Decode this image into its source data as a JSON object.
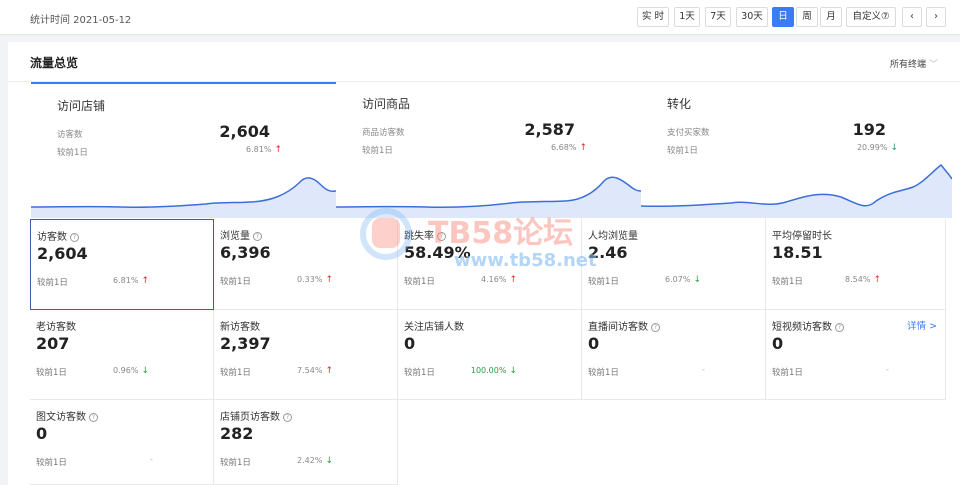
{
  "header": {
    "stat_time": "统计时间 2021-05-12",
    "buttons": [
      {
        "label": "实 时",
        "active": false
      },
      {
        "label": "1天",
        "active": false
      },
      {
        "label": "7天",
        "active": false
      },
      {
        "label": "30天",
        "active": false
      },
      {
        "label": "日",
        "active": true
      },
      {
        "label": "周",
        "active": false
      },
      {
        "label": "月",
        "active": false
      },
      {
        "label": "自定义⑦",
        "active": false
      }
    ],
    "prev_icon": "chevron-left-icon",
    "next_icon": "chevron-right-icon"
  },
  "panel": {
    "title": "流量总览",
    "terminal_select": "所有终端"
  },
  "summary": [
    {
      "title": "访问店铺",
      "label": "访客数",
      "value": "2,604",
      "compare": "较前1日",
      "pct": "6.81%",
      "trend": "up",
      "active": true
    },
    {
      "title": "访问商品",
      "label": "商品访客数",
      "value": "2,587",
      "compare": "较前1日",
      "pct": "6.68%",
      "trend": "up",
      "active": false
    },
    {
      "title": "转化",
      "label": "支付买家数",
      "value": "192",
      "compare": "较前1日",
      "pct": "20.99%",
      "trend": "down",
      "active": false
    }
  ],
  "metrics": [
    {
      "title": "访客数",
      "help": true,
      "value": "2,604",
      "compare": "较前1日",
      "pct": "6.81%",
      "trend": "up",
      "selected": true
    },
    {
      "title": "浏览量",
      "help": true,
      "value": "6,396",
      "compare": "较前1日",
      "pct": "0.33%",
      "trend": "up"
    },
    {
      "title": "跳失率",
      "help": true,
      "value": "58.49%",
      "compare": "较前1日",
      "pct": "4.16%",
      "trend": "up"
    },
    {
      "title": "人均浏览量",
      "help": false,
      "value": "2.46",
      "compare": "较前1日",
      "pct": "6.07%",
      "trend": "down"
    },
    {
      "title": "平均停留时长",
      "help": false,
      "value": "18.51",
      "compare": "较前1日",
      "pct": "8.54%",
      "trend": "up"
    },
    {
      "title": "老访客数",
      "help": false,
      "value": "207",
      "compare": "较前1日",
      "pct": "0.96%",
      "trend": "down"
    },
    {
      "title": "新访客数",
      "help": false,
      "value": "2,397",
      "compare": "较前1日",
      "pct": "7.54%",
      "trend": "up"
    },
    {
      "title": "关注店铺人数",
      "help": false,
      "value": "0",
      "compare": "较前1日",
      "pct": "100.00%",
      "trend": "down",
      "green": true
    },
    {
      "title": "直播间访客数",
      "help": true,
      "value": "0",
      "compare": "较前1日",
      "pct": "-",
      "trend": "none"
    },
    {
      "title": "短视频访客数",
      "help": true,
      "value": "0",
      "compare": "较前1日",
      "pct": "-",
      "trend": "none",
      "detail": "详情 >"
    },
    {
      "title": "图文访客数",
      "help": true,
      "value": "0",
      "compare": "较前1日",
      "pct": "-",
      "trend": "none"
    },
    {
      "title": "店铺页访客数",
      "help": true,
      "value": "282",
      "compare": "较前1日",
      "pct": "2.42%",
      "trend": "down"
    }
  ],
  "watermark": {
    "text": "TB58论坛",
    "url": "www.tb58.net"
  },
  "colors": {
    "accent": "#3b7bf7",
    "up": "#f5222d",
    "down": "#21a24a",
    "spark_line": "#3b6fd8",
    "spark_fill": "#dfe8fb"
  }
}
